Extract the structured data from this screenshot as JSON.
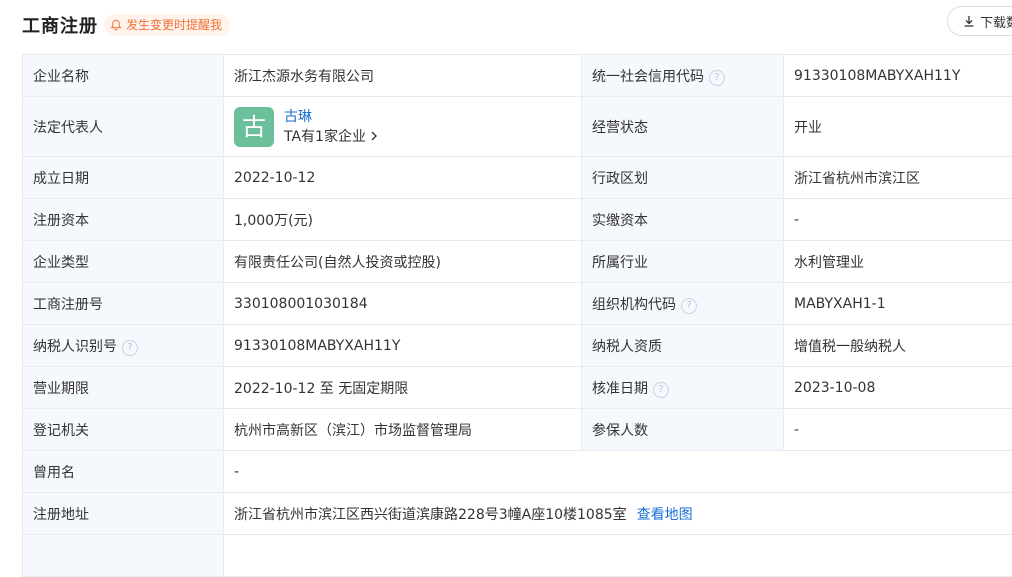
{
  "header": {
    "title": "工商注册",
    "notice": "发生变更时提醒我",
    "download_label": "下载数"
  },
  "table": {
    "r1": {
      "l1": "企业名称",
      "v1": "浙江杰源水务有限公司",
      "l2": "统一社会信用代码",
      "v2": "91330108MABYXAH11Y"
    },
    "r2": {
      "l1": "法定代表人",
      "avatar_char": "古",
      "rep_name": "古琳",
      "rep_sub": "TA有1家企业",
      "l2": "经营状态",
      "v2": "开业"
    },
    "r3": {
      "l1": "成立日期",
      "v1": "2022-10-12",
      "l2": "行政区划",
      "v2": "浙江省杭州市滨江区"
    },
    "r4": {
      "l1": "注册资本",
      "v1": "1,000万(元)",
      "l2": "实缴资本",
      "v2": "-"
    },
    "r5": {
      "l1": "企业类型",
      "v1": "有限责任公司(自然人投资或控股)",
      "l2": "所属行业",
      "v2": "水利管理业"
    },
    "r6": {
      "l1": "工商注册号",
      "v1": "330108001030184",
      "l2": "组织机构代码",
      "v2": "MABYXAH1-1"
    },
    "r7": {
      "l1": "纳税人识别号",
      "v1": "91330108MABYXAH11Y",
      "l2": "纳税人资质",
      "v2": "增值税一般纳税人"
    },
    "r8": {
      "l1": "营业期限",
      "v1": "2022-10-12 至 无固定期限",
      "l2": "核准日期",
      "v2": "2023-10-08"
    },
    "r9": {
      "l1": "登记机关",
      "v1": "杭州市高新区（滨江）市场监督管理局",
      "l2": "参保人数",
      "v2": "-"
    },
    "r10": {
      "l1": "曾用名",
      "v1": "-"
    },
    "r11": {
      "l1": "注册地址",
      "v1": "浙江省杭州市滨江区西兴街道滨康路228号3幢A座10楼1085室",
      "link": "查看地图"
    }
  },
  "colors": {
    "accent_link": "#1a6ed4",
    "notice_text": "#f07136",
    "notice_bg": "#fff3ec",
    "label_bg": "#f5f8fc",
    "border": "#e8eaef",
    "avatar_bg": "#6bbf9a"
  },
  "icons": {
    "notice": "bell-icon",
    "download": "download-icon",
    "help": "question-circle-icon",
    "chevron": "chevron-right-icon"
  }
}
